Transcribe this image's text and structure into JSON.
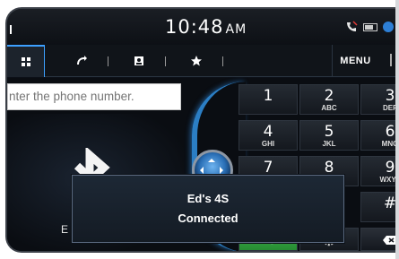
{
  "status_bar": {
    "time": "10:48",
    "ampm": "AM"
  },
  "tabs": {
    "items": [
      {
        "name": "dial-pad",
        "icon": "keypad-icon"
      },
      {
        "name": "recent-calls",
        "icon": "recent-calls-icon"
      },
      {
        "name": "contacts",
        "icon": "contacts-icon"
      },
      {
        "name": "favorites",
        "icon": "star-icon"
      }
    ],
    "menu_label": "MENU"
  },
  "dialer": {
    "input_placeholder": "nter the phone number.",
    "device_name_partial": "E"
  },
  "keypad": {
    "keys": [
      {
        "digit": "1",
        "letters": ""
      },
      {
        "digit": "2",
        "letters": "ABC"
      },
      {
        "digit": "3",
        "letters": "DEF"
      },
      {
        "digit": "4",
        "letters": "GHI"
      },
      {
        "digit": "5",
        "letters": "JKL"
      },
      {
        "digit": "6",
        "letters": "MNO"
      },
      {
        "digit": "7",
        "letters": ""
      },
      {
        "digit": "8",
        "letters": ""
      },
      {
        "digit": "9",
        "letters": "WXYZ"
      },
      {
        "digit": "#",
        "letters": ""
      }
    ]
  },
  "popup": {
    "device": "Ed's 4S",
    "status": "Connected"
  },
  "colors": {
    "accent_blue": "#2b7ec4",
    "call_green": "#3fb24a"
  }
}
